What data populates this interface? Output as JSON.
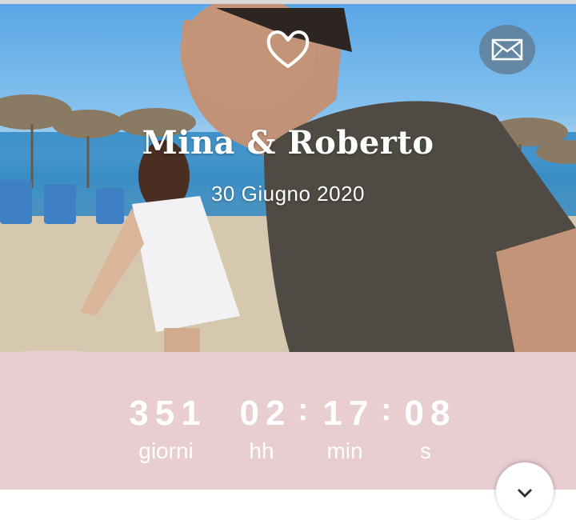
{
  "header": {
    "names": "Mina & Roberto",
    "date": "30 Giugno 2020",
    "heart_icon": "heart-outline-icon",
    "envelope_icon": "envelope-icon"
  },
  "countdown": {
    "days": "351",
    "hours": "02",
    "minutes": "17",
    "seconds": "08",
    "separator": ":",
    "labels": {
      "days": "giorni",
      "hours": "hh",
      "minutes": "min",
      "seconds": "s"
    }
  },
  "colors": {
    "countdown_background": "#e8cdd1",
    "text": "#ffffff"
  },
  "fab": {
    "icon": "chevron-down-icon"
  }
}
